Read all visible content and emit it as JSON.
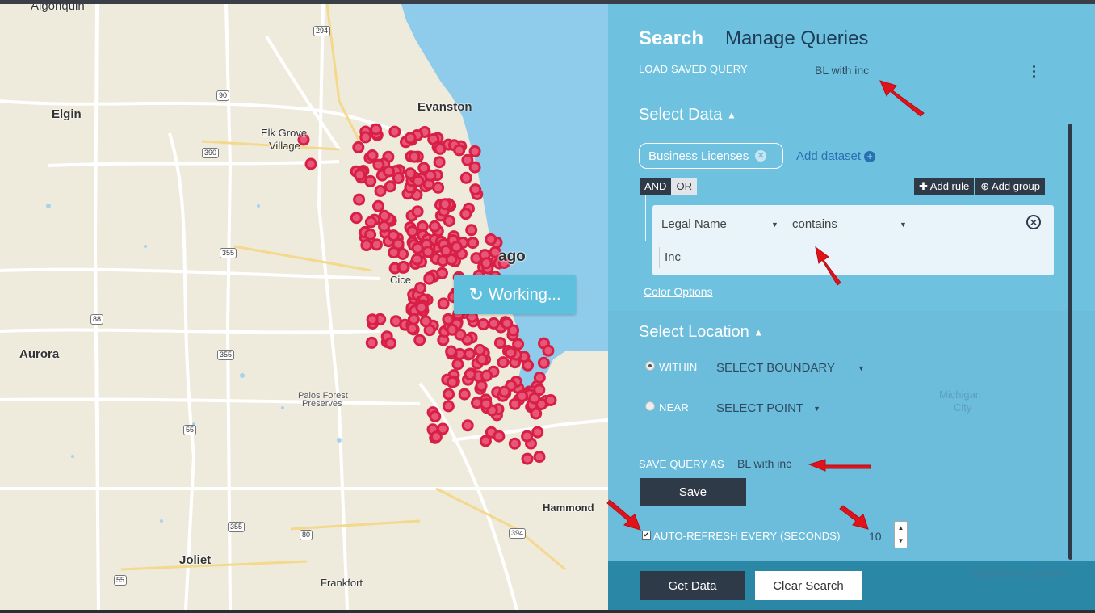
{
  "map": {
    "cities": [
      "Algonquin",
      "Elgin",
      "Evanston",
      "Elk Grove",
      "Village",
      "Cice",
      "ago",
      "Aurora",
      "Palos Forest",
      "Preserves",
      "Hammond",
      "Joliet",
      "Frankfort"
    ],
    "shields": [
      "294",
      "90",
      "390",
      "355",
      "88",
      "355",
      "55",
      "80",
      "394",
      "55",
      "355"
    ],
    "working_label": "Working...",
    "marker_color": "#d81f45"
  },
  "panel": {
    "tabs": {
      "search": "Search",
      "manage": "Manage Queries"
    },
    "load_saved_label": "LOAD SAVED QUERY",
    "load_saved_value": "BL with inc",
    "select_data": {
      "title": "Select Data",
      "dataset_chip": "Business Licenses",
      "add_dataset": "Add dataset",
      "and_label": "AND",
      "or_label": "OR",
      "add_rule": "Add rule",
      "add_group": "Add group",
      "rule": {
        "field": "Legal Name",
        "operator": "contains",
        "value": "Inc"
      },
      "color_options": "Color Options"
    },
    "select_location": {
      "title": "Select Location",
      "within_label": "WITHIN",
      "within_value": "SELECT BOUNDARY",
      "near_label": "NEAR",
      "near_value": "SELECT POINT"
    },
    "save_query": {
      "label": "SAVE QUERY AS",
      "value": "BL with inc",
      "save_button": "Save"
    },
    "auto_refresh": {
      "label": "AUTO-REFRESH EVERY (SECONDS)",
      "value": "10",
      "checked": true
    },
    "background_labels": [
      "Michigan",
      "City",
      "Business Licenses"
    ]
  },
  "footer": {
    "get_data": "Get Data",
    "clear_search": "Clear Search"
  },
  "colors": {
    "panel": "#6ec2e0",
    "dark_button": "#2e3a48",
    "arrow": "#e2121b"
  }
}
